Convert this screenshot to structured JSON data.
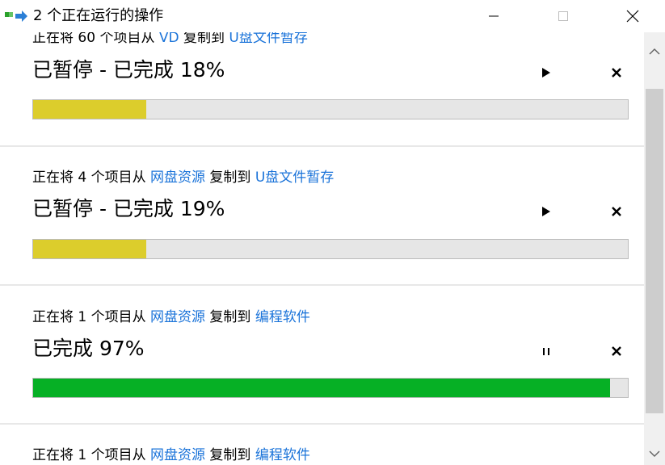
{
  "window": {
    "title": "2 个正在运行的操作",
    "icons": {
      "app": "copy-progress-icon",
      "minimize": "minimize-icon",
      "maximize": "maximize-icon",
      "close": "close-icon"
    }
  },
  "operations": [
    {
      "line": {
        "pre": "正在将 60 个项目从 ",
        "src": "VD",
        "mid": " 复制到 ",
        "dst": "U盘文件暂存"
      },
      "status": "已暂停 - 已完成 18%",
      "progress": 0.19,
      "state": "paused",
      "action_icon": "play-icon",
      "fill_color": "#dccd2c"
    },
    {
      "line": {
        "pre": "正在将 4 个项目从 ",
        "src": "网盘资源",
        "mid": " 复制到 ",
        "dst": "U盘文件暂存"
      },
      "status": "已暂停 - 已完成 19%",
      "progress": 0.19,
      "state": "paused",
      "action_icon": "play-icon",
      "fill_color": "#dccd2c"
    },
    {
      "line": {
        "pre": "正在将 1 个项目从 ",
        "src": "网盘资源",
        "mid": " 复制到 ",
        "dst": "编程软件"
      },
      "status": "已完成 97%",
      "progress": 0.97,
      "state": "running",
      "action_icon": "pause-icon",
      "fill_color": "#06b025"
    },
    {
      "line": {
        "pre": "正在将 1 个项目从 ",
        "src": "网盘资源",
        "mid": " 复制到 ",
        "dst": "编程软件"
      }
    }
  ],
  "colors": {
    "link": "#1a73d9",
    "paused": "#dccd2c",
    "running": "#06b025",
    "track": "#e6e6e6"
  },
  "scrollbar": {
    "up_icon": "chevron-up-icon",
    "down_icon": "chevron-down-icon"
  }
}
